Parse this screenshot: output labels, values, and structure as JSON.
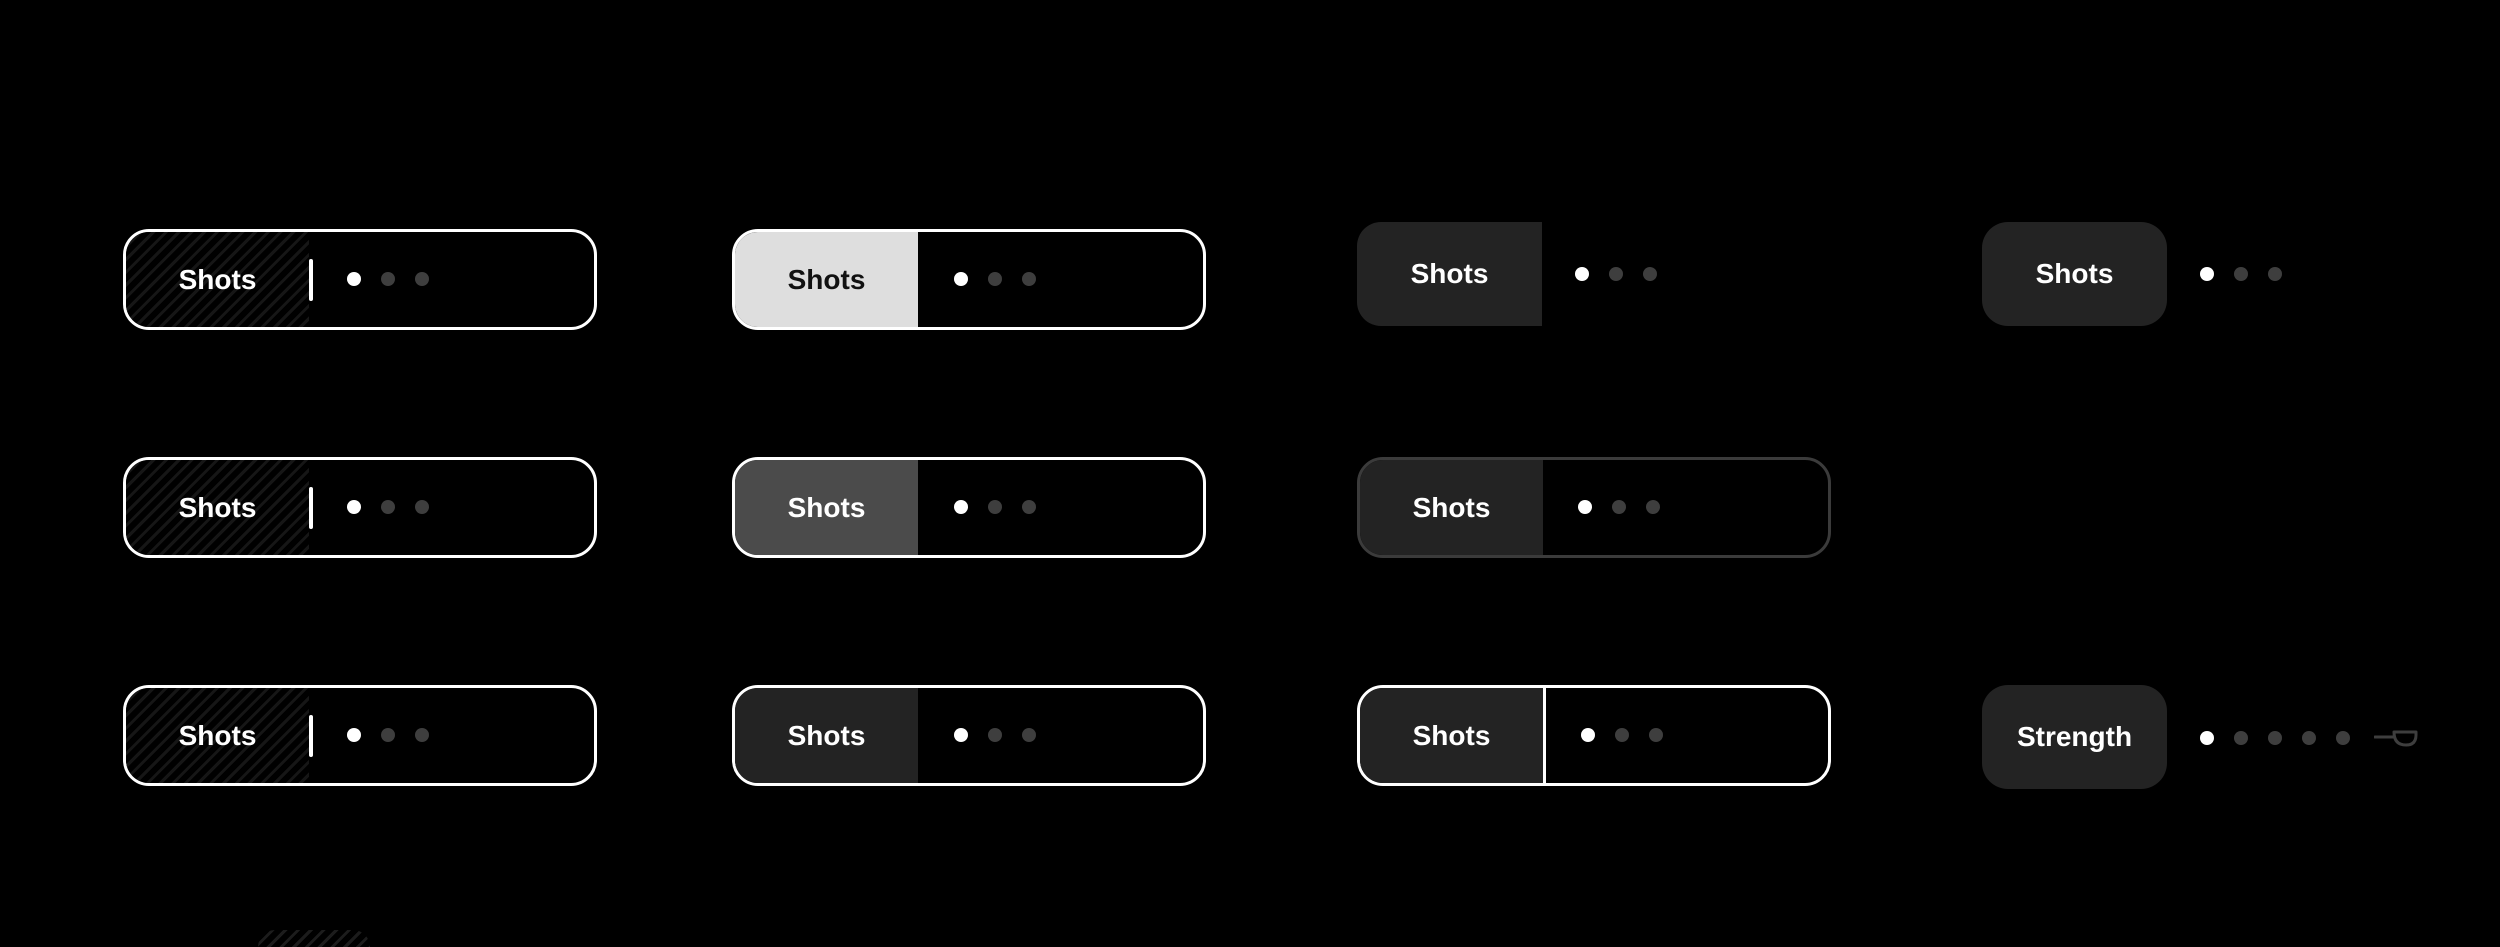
{
  "controls": [
    {
      "label": "Shots",
      "dots": 3,
      "active_dot": 1
    },
    {
      "label": "Shots",
      "dots": 3,
      "active_dot": 1
    },
    {
      "label": "Shots",
      "dots": 3,
      "active_dot": 1
    },
    {
      "label": "Shots",
      "dots": 3,
      "active_dot": 1
    },
    {
      "label": "Shots",
      "dots": 3,
      "active_dot": 1
    },
    {
      "label": "Shots",
      "dots": 3,
      "active_dot": 1
    },
    {
      "label": "Shots",
      "dots": 3,
      "active_dot": 1
    },
    {
      "label": "Shots",
      "dots": 3,
      "active_dot": 1
    },
    {
      "label": "Shots",
      "dots": 3,
      "active_dot": 1
    },
    {
      "label": "Shots",
      "dots": 3,
      "active_dot": 1
    },
    {
      "label": "Strength",
      "dots": 5,
      "active_dot": 1,
      "icon": "coffee-scoop-icon"
    }
  ],
  "colors": {
    "background": "#000000",
    "outline": "#ffffff",
    "segment_dark": "#232323",
    "segment_mid": "#4b4b4b",
    "segment_light": "#dedede",
    "dot_active": "#ffffff",
    "dot_inactive": "#3e3e3e"
  }
}
